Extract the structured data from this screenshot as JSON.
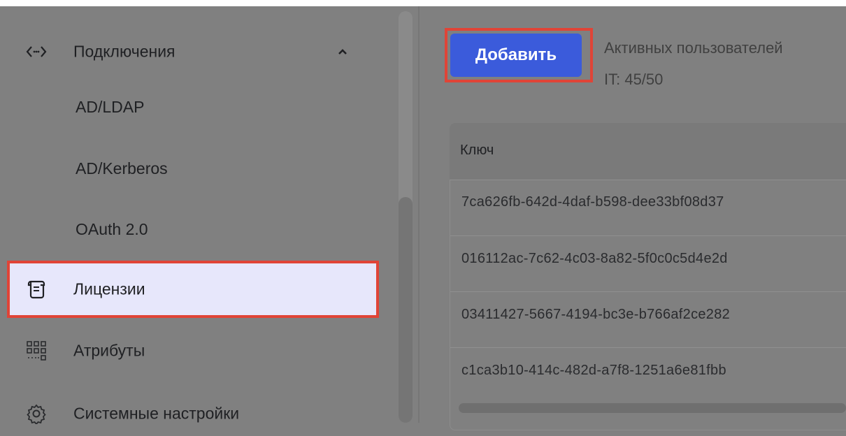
{
  "sidebar": {
    "connections": {
      "label": "Подключения",
      "icon": "code-brackets-icon",
      "expanded": true
    },
    "sub_items": [
      {
        "label": "AD/LDAP"
      },
      {
        "label": "AD/Kerberos"
      },
      {
        "label": "OAuth 2.0"
      }
    ],
    "licenses": {
      "label": "Лицензии",
      "icon": "scroll-icon",
      "active": true
    },
    "attributes": {
      "label": "Атрибуты",
      "icon": "grid-icon"
    },
    "system_settings": {
      "label": "Системные настройки",
      "icon": "gear-icon"
    }
  },
  "main": {
    "add_button": "Добавить",
    "active_users_line1": "Активных пользователей",
    "active_users_line2": "IT: 45/50",
    "table": {
      "columns": [
        "Ключ"
      ],
      "rows": [
        "7ca626fb-642d-4daf-b598-dee33bf08d37",
        "016112ac-7c62-4c03-8a82-5f0c0c5d4e2d",
        "03411427-5667-4194-bc3e-b766af2ce282",
        "c1ca3b10-414c-482d-a7f8-1251a6e81fbb"
      ]
    }
  },
  "colors": {
    "accent": "#3b5bdb",
    "highlight": "#e04437",
    "active_bg": "#e7e7fb"
  }
}
